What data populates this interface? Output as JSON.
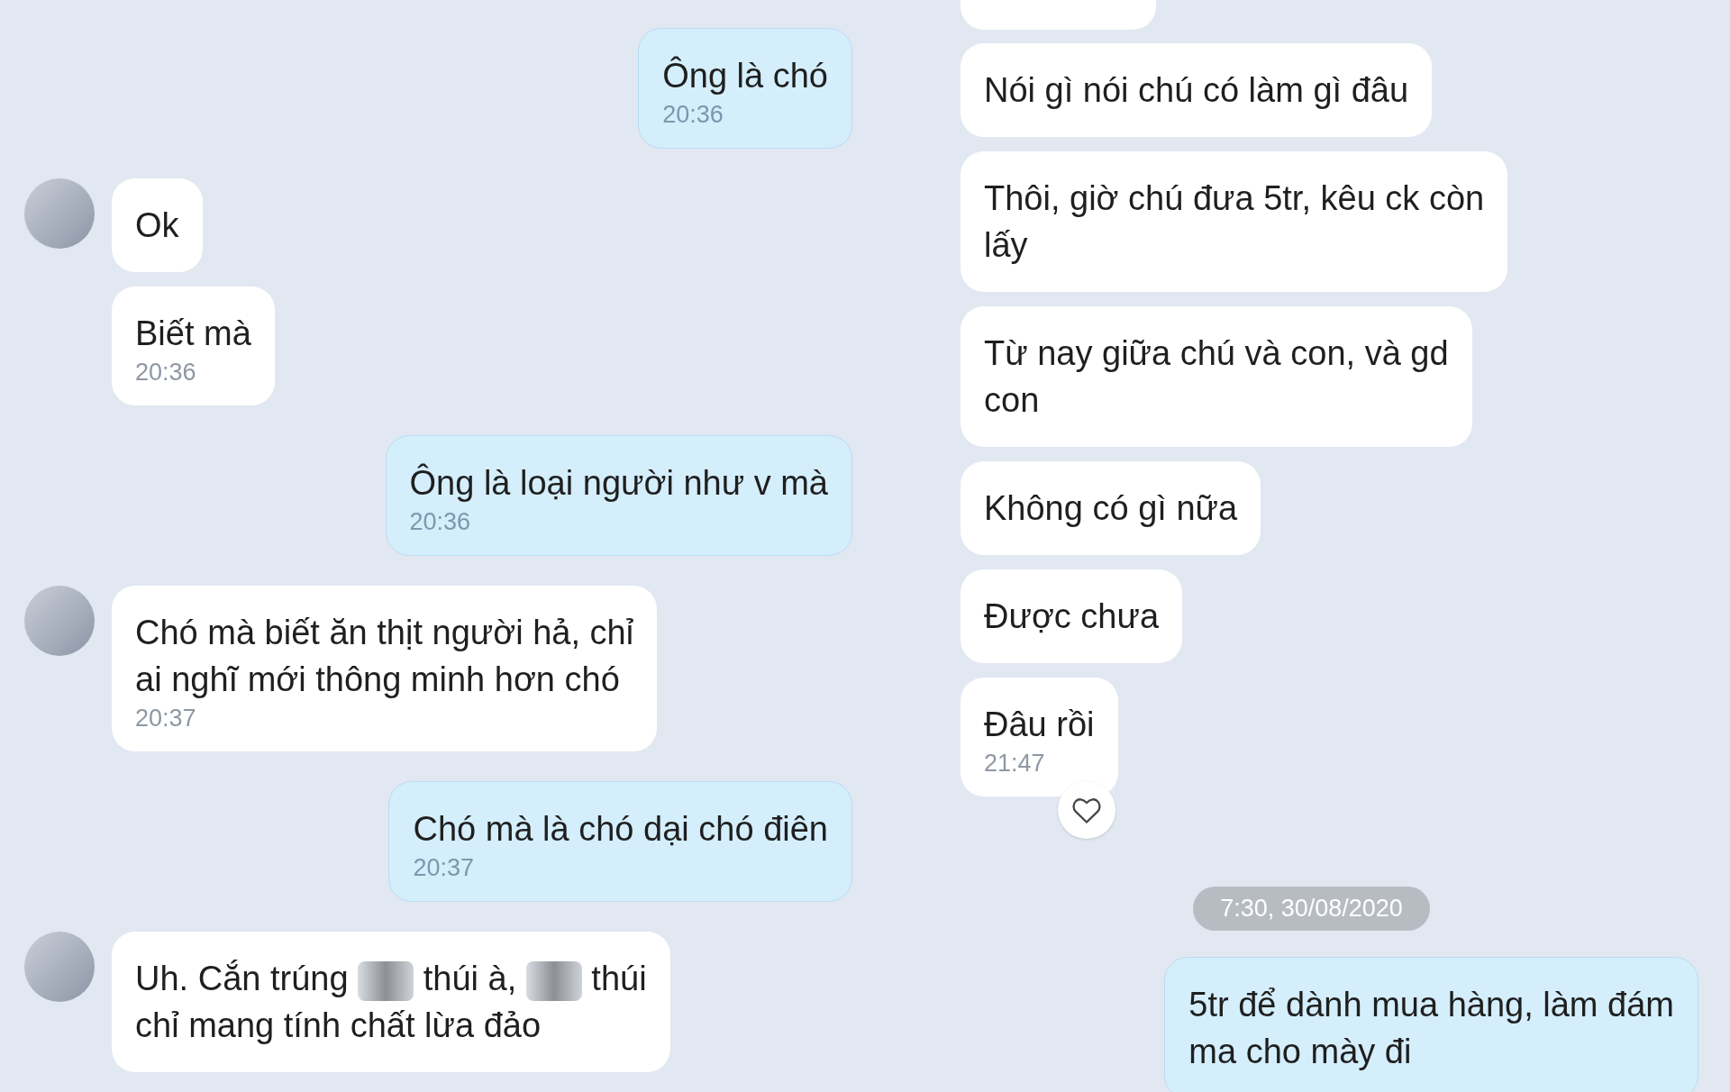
{
  "columns": [
    {
      "messages": [
        {
          "kind": "message",
          "sent": true,
          "text": "Ông là chó",
          "time": "20:36"
        },
        {
          "kind": "message",
          "sent": false,
          "avatar": true,
          "text": "Ok"
        },
        {
          "kind": "message",
          "sent": false,
          "avatar": false,
          "text": "Biết mà",
          "time": "20:36"
        },
        {
          "kind": "message",
          "sent": true,
          "text": "Ông là loại người như v mà",
          "time": "20:36"
        },
        {
          "kind": "message",
          "sent": false,
          "avatar": true,
          "text": "Chó mà biết ăn thịt người hả, chỉ\nai nghĩ mới thông minh hơn chó",
          "time": "20:37"
        },
        {
          "kind": "message",
          "sent": true,
          "text": "Chó mà là chó dại chó điên",
          "time": "20:37"
        },
        {
          "kind": "redacted",
          "sent": false,
          "avatar": true,
          "segments": [
            "Uh. Cắn trúng",
            "thúi à,",
            "thúi\nchỉ mang tính chất lừa đảo"
          ]
        }
      ]
    },
    {
      "messages": [
        {
          "kind": "cut"
        },
        {
          "kind": "message",
          "sent": false,
          "avatar": false,
          "text": "Nói gì nói chú có làm gì đâu"
        },
        {
          "kind": "message",
          "sent": false,
          "avatar": false,
          "text": "Thôi, giờ chú đưa 5tr, kêu ck còn\nlấy"
        },
        {
          "kind": "message",
          "sent": false,
          "avatar": false,
          "text": "Từ nay giữa chú và con, và gd\ncon"
        },
        {
          "kind": "message",
          "sent": false,
          "avatar": false,
          "text": "Không có gì nữa"
        },
        {
          "kind": "message",
          "sent": false,
          "avatar": false,
          "text": "Được chưa"
        },
        {
          "kind": "message",
          "sent": false,
          "avatar": false,
          "text": "Đâu rồi",
          "time": "21:47",
          "reacted": true
        },
        {
          "kind": "date",
          "text": "7:30, 30/08/2020"
        },
        {
          "kind": "message",
          "sent": true,
          "text": "5tr để dành mua hàng, làm đám\nma cho mày đi"
        }
      ]
    }
  ]
}
